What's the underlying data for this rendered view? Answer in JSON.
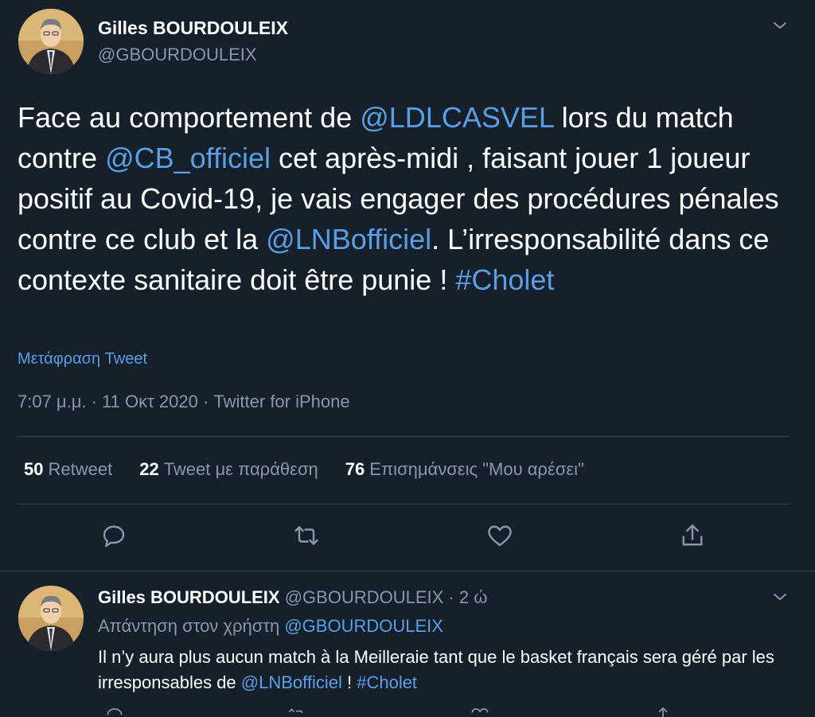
{
  "main_tweet": {
    "display_name": "Gilles BOURDOULEIX",
    "handle": "@GBOURDOULEIX",
    "text_parts": [
      {
        "t": "Face au comportement de ",
        "link": false
      },
      {
        "t": "@LDLCASVEL",
        "link": true
      },
      {
        "t": " lors du match contre ",
        "link": false
      },
      {
        "t": "@CB_officiel",
        "link": true
      },
      {
        "t": " cet après-midi , faisant jouer 1 joueur positif au Covid-19, je vais engager des procédures pénales contre ce club et la ",
        "link": false
      },
      {
        "t": "@LNBofficiel",
        "link": true
      },
      {
        "t": ". L’irresponsabilité dans ce contexte sanitaire doit être punie ! ",
        "link": false
      },
      {
        "t": "#Cholet",
        "link": true
      }
    ],
    "translate_label": "Μετάφραση Tweet",
    "meta": "7:07 μ.μ. · 11 Οκτ 2020 · Twitter for iPhone",
    "stats": [
      {
        "count": "50",
        "label": "Retweet"
      },
      {
        "count": "22",
        "label": "Tweet με παράθεση"
      },
      {
        "count": "76",
        "label": "Επισημάνσεις \"Μου αρέσει\""
      }
    ],
    "action_icons": [
      "reply-icon",
      "retweet-icon",
      "like-icon",
      "share-icon"
    ]
  },
  "reply_tweet": {
    "display_name": "Gilles BOURDOULEIX",
    "handle_time": "@GBOURDOULEIX · 2 ώ",
    "reply_to_label": "Απάντηση στον χρήστη",
    "reply_to_handle": "@GBOURDOULEIX",
    "text_parts": [
      {
        "t": "Il n’y aura plus aucun match à la Meilleraie tant que le basket français sera géré par les irresponsables de ",
        "link": false
      },
      {
        "t": "@LNBofficiel",
        "link": true
      },
      {
        "t": " ! ",
        "link": false
      },
      {
        "t": "#Cholet",
        "link": true
      }
    ]
  },
  "colors": {
    "background": "#15202b",
    "link": "#5a9ee6",
    "secondary_text": "#8899a6",
    "divider": "#38444d"
  }
}
